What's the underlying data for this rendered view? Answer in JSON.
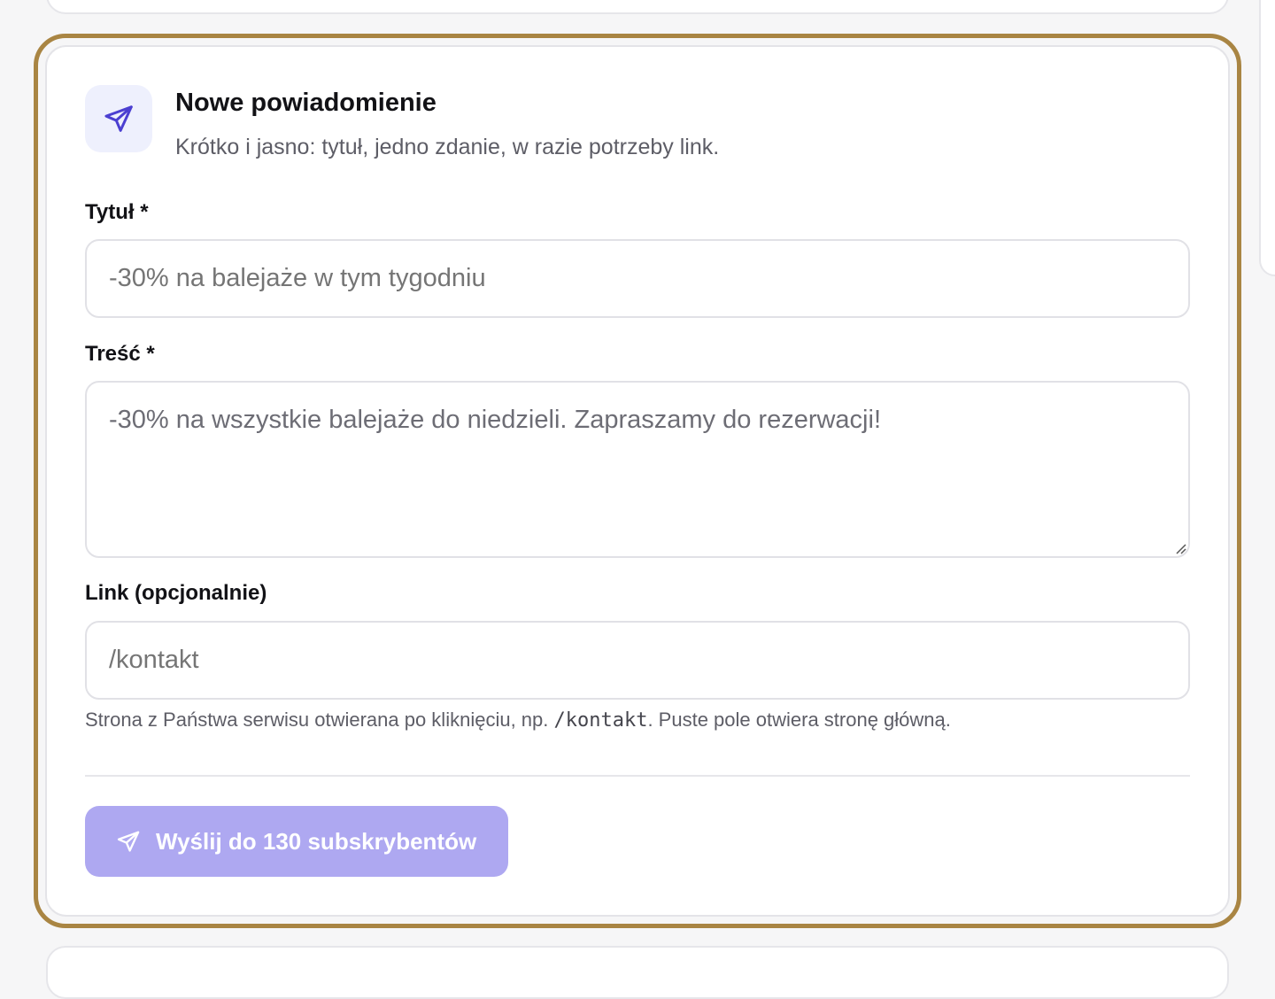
{
  "colors": {
    "focus_ring": "#a98543",
    "accent": "#4b3fd1",
    "icon_bg": "#eef0fd",
    "button_bg_disabled": "#aea8f1"
  },
  "header": {
    "icon": "paper-plane-icon",
    "title": "Nowe powiadomienie",
    "subtitle": "Krótko i jasno: tytuł, jedno zdanie, w razie potrzeby link."
  },
  "form": {
    "title_field": {
      "label": "Tytuł *",
      "placeholder": "-30% na balejaże w tym tygodniu"
    },
    "body_field": {
      "label": "Treść *",
      "placeholder": "-30% na wszystkie balejaże do niedzieli. Zapraszamy do rezerwacji!"
    },
    "link_field": {
      "label": "Link (opcjonalnie)",
      "placeholder": "/kontakt",
      "hint_before": "Strona z Państwa serwisu otwierana po kliknięciu, np. ",
      "hint_code": "/kontakt",
      "hint_after": ". Puste pole otwiera stronę główną."
    }
  },
  "send_button": {
    "icon": "paper-plane-icon",
    "label": "Wyślij do 130 subskrybentów"
  }
}
